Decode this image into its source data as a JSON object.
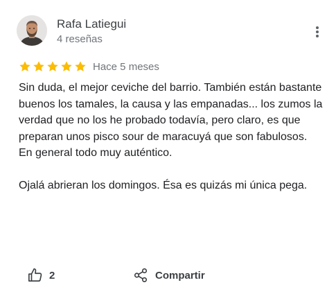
{
  "review": {
    "author": {
      "name": "Rafa Latiegui",
      "reviews_count": "4 reseñas",
      "avatar_icon": "user-avatar-photo"
    },
    "rating": {
      "stars": 5,
      "max": 5,
      "color": "#fbbc04"
    },
    "time": "Hace 5 meses",
    "body": {
      "paragraph1": "Sin duda, el mejor ceviche del barrio. También están bastante buenos los tamales, la causa y las empanadas... los zumos la verdad que no los he probado todavía, pero claro, es que preparan unos pisco sour de maracuyá que son fabulosos. En general todo muy auténtico.",
      "paragraph2": "Ojalá abrieran los domingos. Ésa es quizás mi única pega."
    },
    "actions": {
      "like": {
        "icon": "thumbs-up-icon",
        "count": "2"
      },
      "share": {
        "icon": "share-icon",
        "label": "Compartir"
      },
      "more": {
        "icon": "more-vert-icon"
      }
    }
  }
}
